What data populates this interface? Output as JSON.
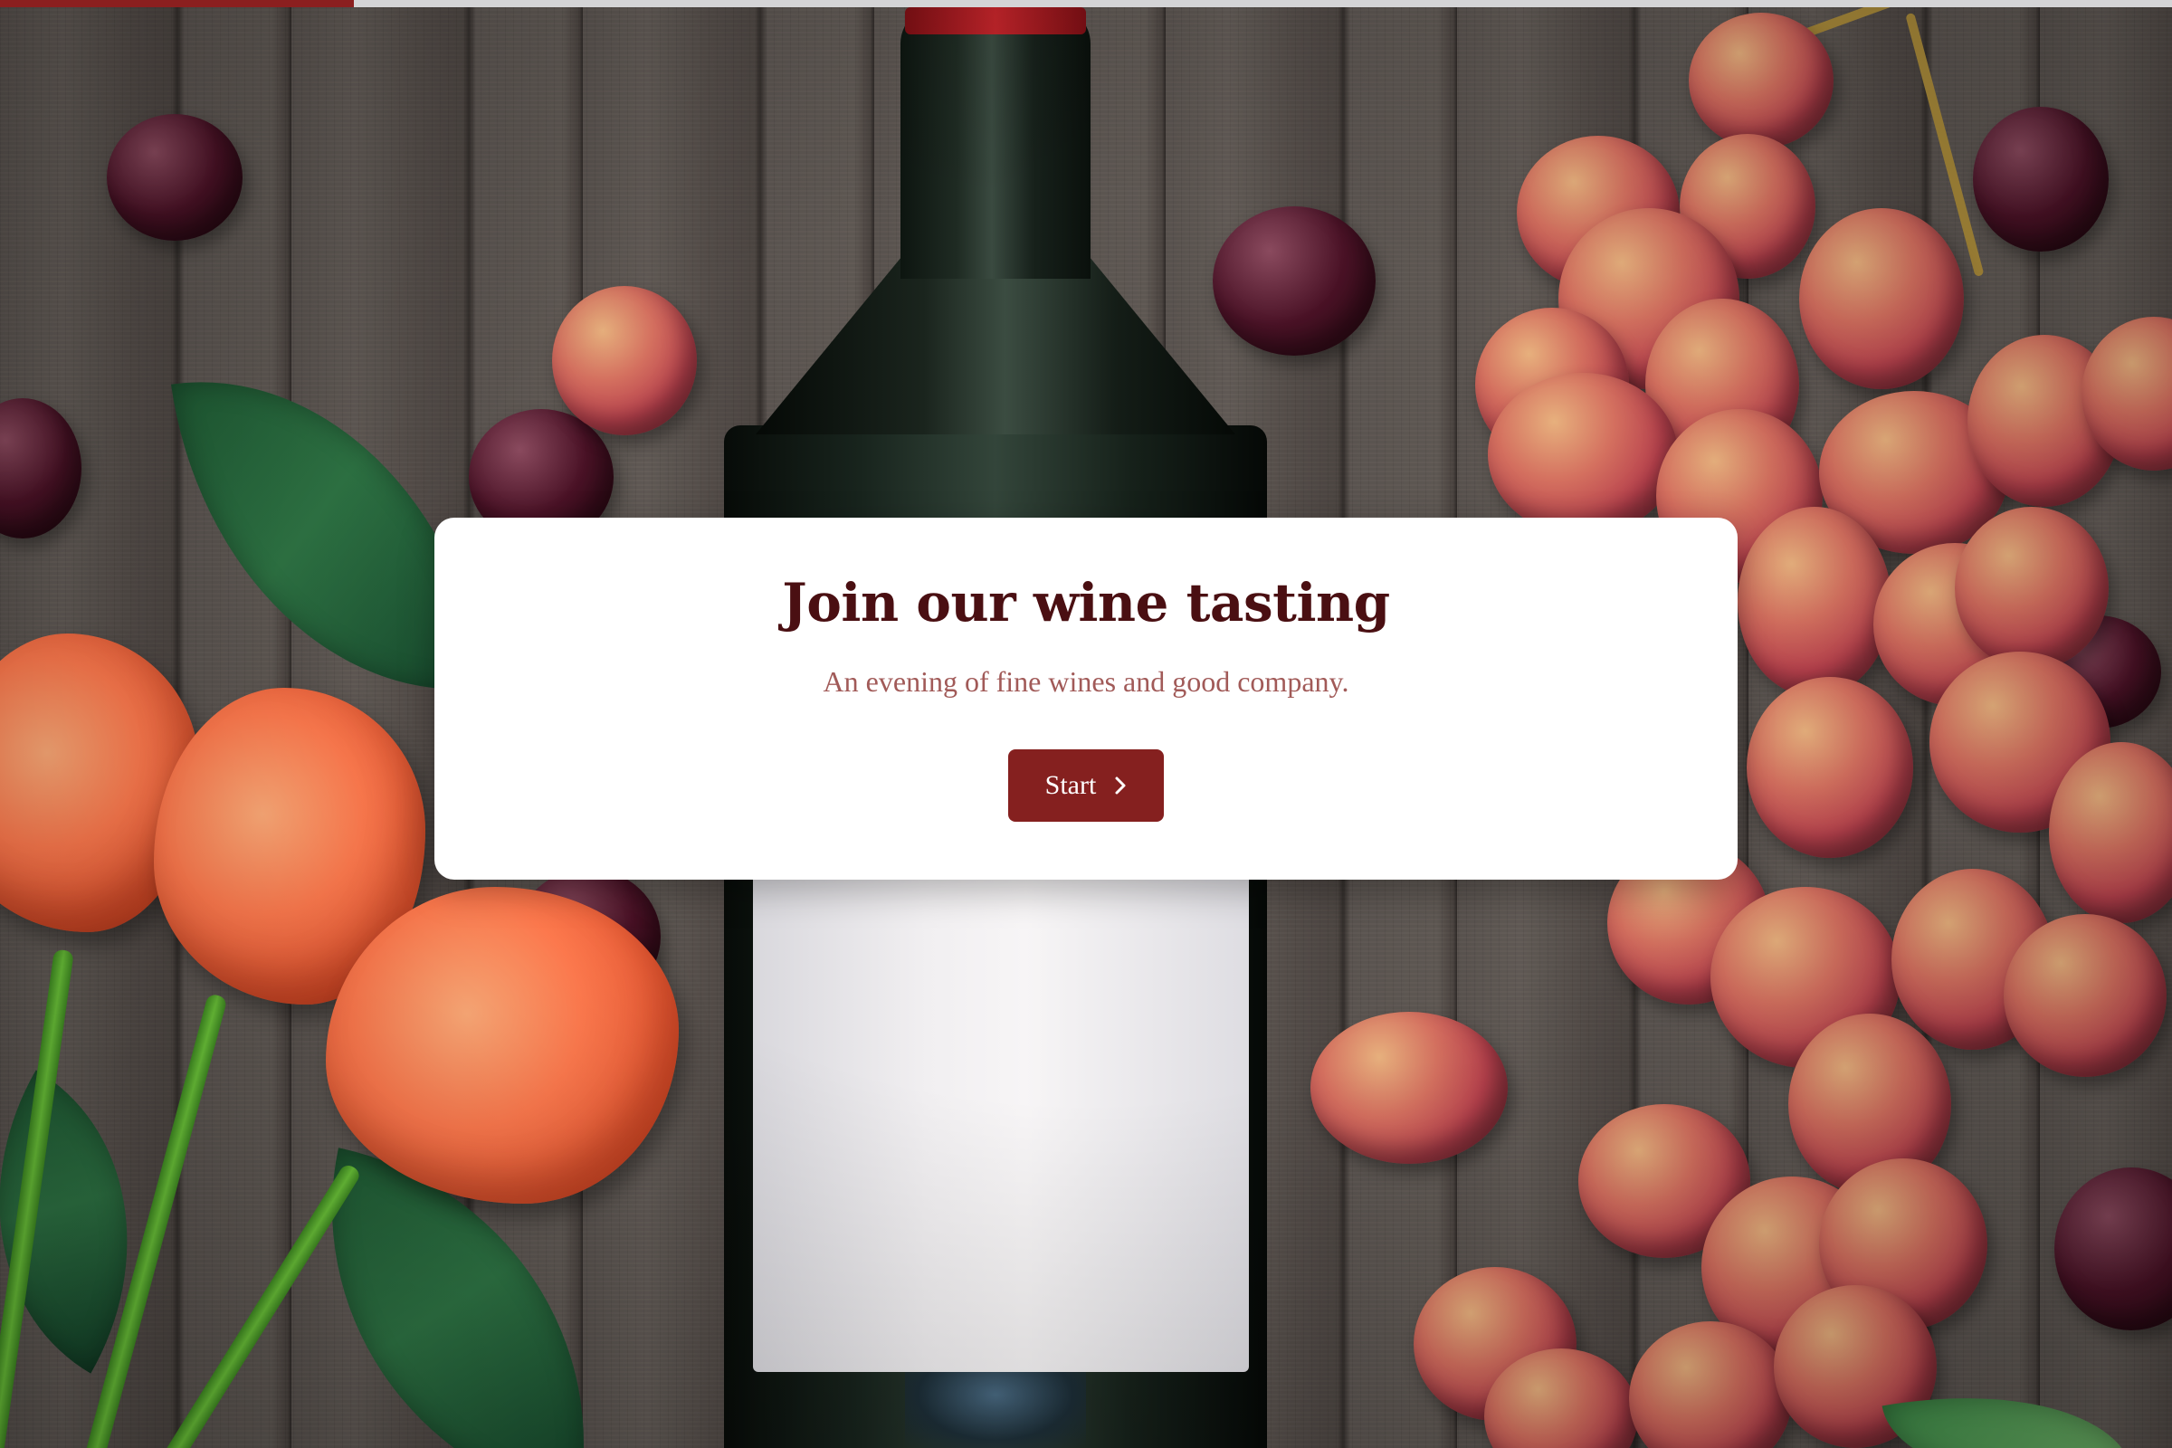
{
  "progress": {
    "fraction": 0.163,
    "fill_color": "#8b1f1f"
  },
  "dialog": {
    "title": "Join our wine tasting",
    "subtitle": "An evening of fine wines and good company.",
    "start_button": {
      "label": "Start",
      "icon": "chevron-right-icon"
    }
  },
  "colors": {
    "title": "#4a0f12",
    "subtitle": "#a15a58",
    "button": "#85201f"
  }
}
